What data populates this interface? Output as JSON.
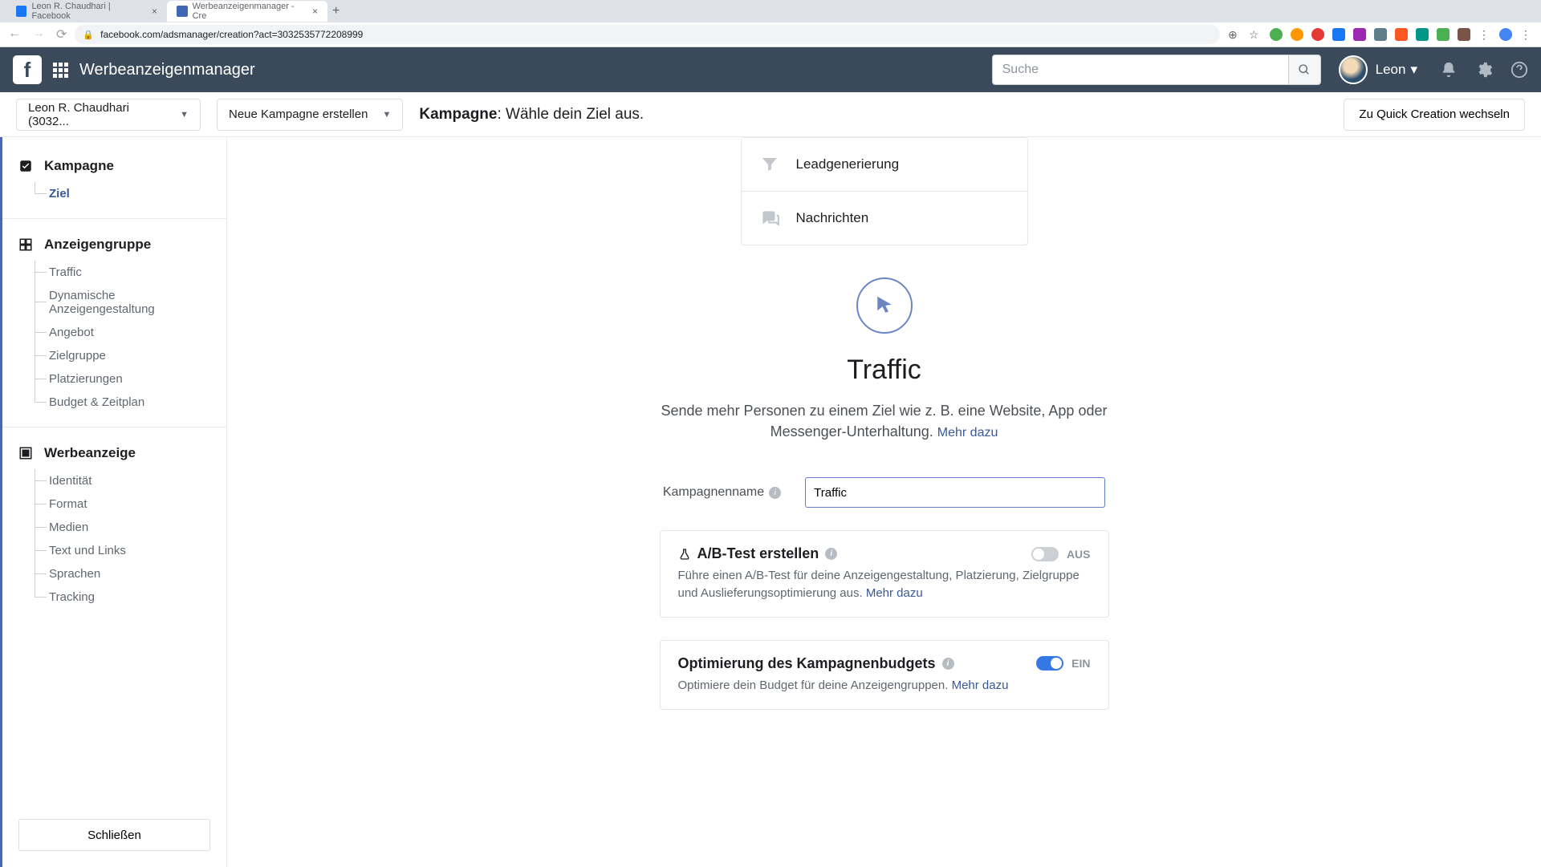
{
  "browser": {
    "tabs": [
      {
        "title": "Leon R. Chaudhari | Facebook",
        "favicon": "#1877f2"
      },
      {
        "title": "Werbeanzeigenmanager - Cre",
        "favicon": "#4267b2"
      }
    ],
    "url": "facebook.com/adsmanager/creation?act=3032535772208999"
  },
  "topnav": {
    "app_title": "Werbeanzeigenmanager",
    "search_placeholder": "Suche",
    "username": "Leon"
  },
  "toolbar": {
    "account_dropdown": "Leon R. Chaudhari (3032...",
    "campaign_dropdown": "Neue Kampagne erstellen",
    "breadcrumb_bold": "Kampagne",
    "breadcrumb_rest": ": Wähle dein Ziel aus.",
    "quick_creation": "Zu Quick Creation wechseln"
  },
  "sidebar": {
    "sections": [
      {
        "title": "Kampagne",
        "items": [
          {
            "label": "Ziel",
            "active": true
          }
        ]
      },
      {
        "title": "Anzeigengruppe",
        "items": [
          {
            "label": "Traffic"
          },
          {
            "label": "Dynamische Anzeigengestaltung"
          },
          {
            "label": "Angebot"
          },
          {
            "label": "Zielgruppe"
          },
          {
            "label": "Platzierungen"
          },
          {
            "label": "Budget & Zeitplan"
          }
        ]
      },
      {
        "title": "Werbeanzeige",
        "items": [
          {
            "label": "Identität"
          },
          {
            "label": "Format"
          },
          {
            "label": "Medien"
          },
          {
            "label": "Text und Links"
          },
          {
            "label": "Sprachen"
          },
          {
            "label": "Tracking"
          }
        ]
      }
    ],
    "close_label": "Schließen"
  },
  "main": {
    "objective_items": [
      {
        "label": "Leadgenerierung",
        "icon": "funnel"
      },
      {
        "label": "Nachrichten",
        "icon": "messages"
      }
    ],
    "traffic_title": "Traffic",
    "traffic_desc": "Sende mehr Personen zu einem Ziel wie z. B. eine Website, App oder Messenger-Unterhaltung.",
    "more_link": "Mehr dazu",
    "campaign_name_label": "Kampagnenname",
    "campaign_name_value": "Traffic",
    "abtest": {
      "title": "A/B-Test erstellen",
      "desc": "Führe einen A/B-Test für deine Anzeigengestaltung, Platzierung, Zielgruppe und Auslieferungsoptimierung aus.",
      "state_label": "AUS",
      "on": false
    },
    "budget": {
      "title": "Optimierung des Kampagnenbudgets",
      "desc": "Optimiere dein Budget für deine Anzeigengruppen.",
      "state_label": "EIN",
      "on": true
    }
  },
  "colors": {
    "accent": "#385898",
    "toggle_on": "#3578e5"
  }
}
